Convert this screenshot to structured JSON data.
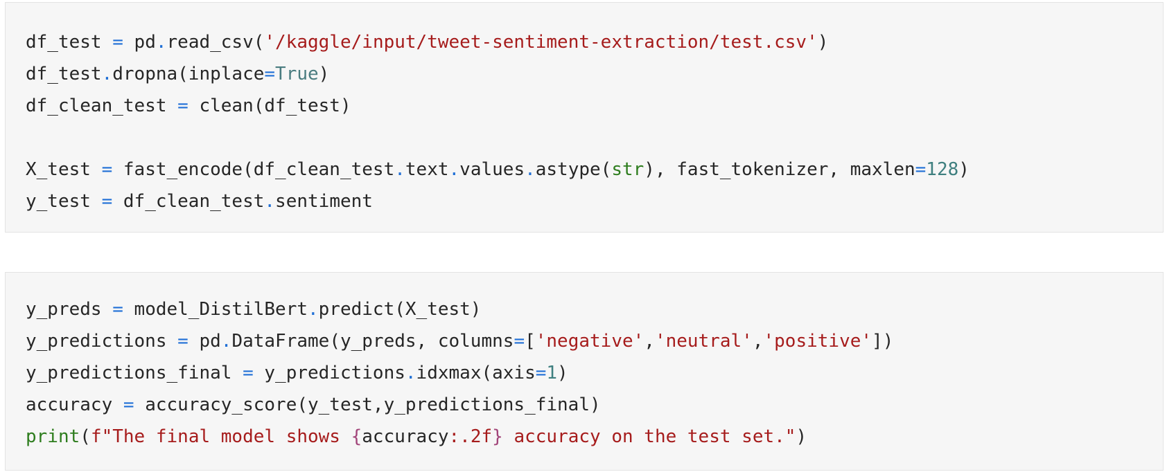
{
  "cells": [
    {
      "lines": [
        [
          {
            "t": "df_test ",
            "c": "tx"
          },
          {
            "t": "=",
            "c": "op"
          },
          {
            "t": " pd",
            "c": "tx"
          },
          {
            "t": ".",
            "c": "op"
          },
          {
            "t": "read_csv(",
            "c": "tx"
          },
          {
            "t": "'/kaggle/input/tweet-sentiment-extraction/test.csv'",
            "c": "str"
          },
          {
            "t": ")",
            "c": "tx"
          }
        ],
        [
          {
            "t": "df_test",
            "c": "tx"
          },
          {
            "t": ".",
            "c": "op"
          },
          {
            "t": "dropna(inplace",
            "c": "tx"
          },
          {
            "t": "=",
            "c": "op"
          },
          {
            "t": "True",
            "c": "kw"
          },
          {
            "t": ")",
            "c": "tx"
          }
        ],
        [
          {
            "t": "df_clean_test ",
            "c": "tx"
          },
          {
            "t": "=",
            "c": "op"
          },
          {
            "t": " clean(df_test)",
            "c": "tx"
          }
        ],
        [],
        [
          {
            "t": "X_test ",
            "c": "tx"
          },
          {
            "t": "=",
            "c": "op"
          },
          {
            "t": " fast_encode(df_clean_test",
            "c": "tx"
          },
          {
            "t": ".",
            "c": "op"
          },
          {
            "t": "text",
            "c": "tx"
          },
          {
            "t": ".",
            "c": "op"
          },
          {
            "t": "values",
            "c": "tx"
          },
          {
            "t": ".",
            "c": "op"
          },
          {
            "t": "astype(",
            "c": "tx"
          },
          {
            "t": "str",
            "c": "bi"
          },
          {
            "t": "), fast_tokenizer, maxlen",
            "c": "tx"
          },
          {
            "t": "=",
            "c": "op"
          },
          {
            "t": "128",
            "c": "num"
          },
          {
            "t": ")",
            "c": "tx"
          }
        ],
        [
          {
            "t": "y_test ",
            "c": "tx"
          },
          {
            "t": "=",
            "c": "op"
          },
          {
            "t": " df_clean_test",
            "c": "tx"
          },
          {
            "t": ".",
            "c": "op"
          },
          {
            "t": "sentiment",
            "c": "tx"
          }
        ]
      ]
    },
    {
      "lines": [
        [
          {
            "t": "y_preds ",
            "c": "tx"
          },
          {
            "t": "=",
            "c": "op"
          },
          {
            "t": " model_DistilBert",
            "c": "tx"
          },
          {
            "t": ".",
            "c": "op"
          },
          {
            "t": "predict(X_test)",
            "c": "tx"
          }
        ],
        [
          {
            "t": "y_predictions ",
            "c": "tx"
          },
          {
            "t": "=",
            "c": "op"
          },
          {
            "t": " pd",
            "c": "tx"
          },
          {
            "t": ".",
            "c": "op"
          },
          {
            "t": "DataFrame(y_preds, columns",
            "c": "tx"
          },
          {
            "t": "=",
            "c": "op"
          },
          {
            "t": "[",
            "c": "tx"
          },
          {
            "t": "'negative'",
            "c": "str"
          },
          {
            "t": ",",
            "c": "tx"
          },
          {
            "t": "'neutral'",
            "c": "str"
          },
          {
            "t": ",",
            "c": "tx"
          },
          {
            "t": "'positive'",
            "c": "str"
          },
          {
            "t": "])",
            "c": "tx"
          }
        ],
        [
          {
            "t": "y_predictions_final ",
            "c": "tx"
          },
          {
            "t": "=",
            "c": "op"
          },
          {
            "t": " y_predictions",
            "c": "tx"
          },
          {
            "t": ".",
            "c": "op"
          },
          {
            "t": "idxmax(axis",
            "c": "tx"
          },
          {
            "t": "=",
            "c": "op"
          },
          {
            "t": "1",
            "c": "num"
          },
          {
            "t": ")",
            "c": "tx"
          }
        ],
        [
          {
            "t": "accuracy ",
            "c": "tx"
          },
          {
            "t": "=",
            "c": "op"
          },
          {
            "t": " accuracy_score(y_test,y_predictions_final)",
            "c": "tx"
          }
        ],
        [
          {
            "t": "print",
            "c": "bi"
          },
          {
            "t": "(",
            "c": "tx"
          },
          {
            "t": "f\"The final model shows ",
            "c": "str"
          },
          {
            "t": "{",
            "c": "fb"
          },
          {
            "t": "accuracy",
            "c": "tx"
          },
          {
            "t": ":.2f",
            "c": "str"
          },
          {
            "t": "}",
            "c": "fb"
          },
          {
            "t": " accuracy on the test set.\"",
            "c": "str"
          },
          {
            "t": ")",
            "c": "tx"
          }
        ]
      ]
    }
  ]
}
